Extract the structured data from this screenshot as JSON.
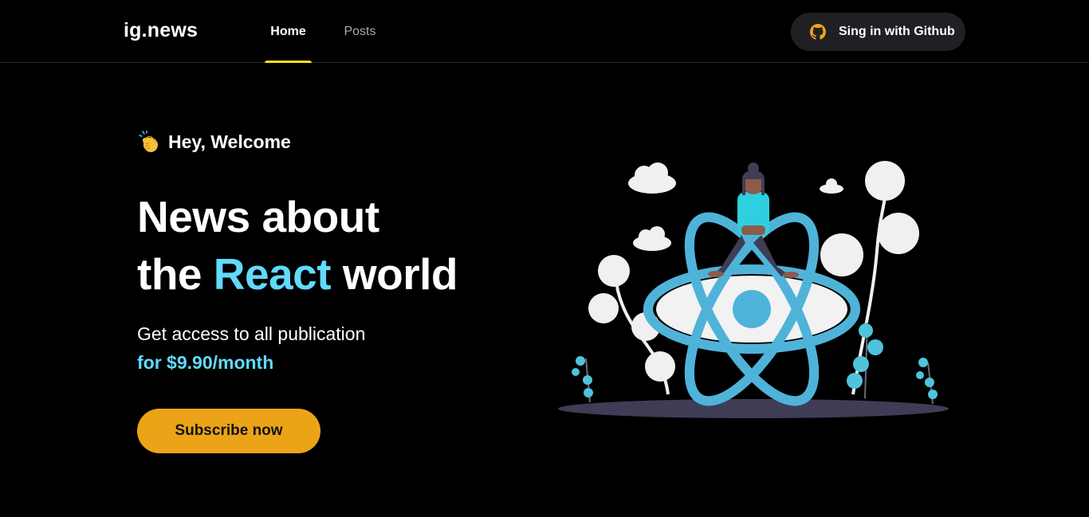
{
  "header": {
    "logo": "ig.news",
    "nav": [
      {
        "label": "Home",
        "active": true
      },
      {
        "label": "Posts",
        "active": false
      }
    ],
    "signin_label": "Sing in with Github",
    "signin_icon": "github-icon"
  },
  "hero": {
    "greeting_icon": "clapping-hands-icon",
    "greeting": "Hey, Welcome",
    "headline_line1": "News about",
    "headline_line2_prefix": "the ",
    "headline_accent": "React",
    "headline_line2_suffix": " world",
    "subtitle": "Get access to all publication",
    "price": "for $9.90/month",
    "subscribe_label": "Subscribe now"
  },
  "colors": {
    "background": "#000000",
    "accent_cyan": "#61dafb",
    "button_yellow": "#eba417",
    "active_underline": "#f8e117",
    "header_button_bg": "#202024"
  },
  "illustration": {
    "icon": "react-atom-illustration"
  }
}
